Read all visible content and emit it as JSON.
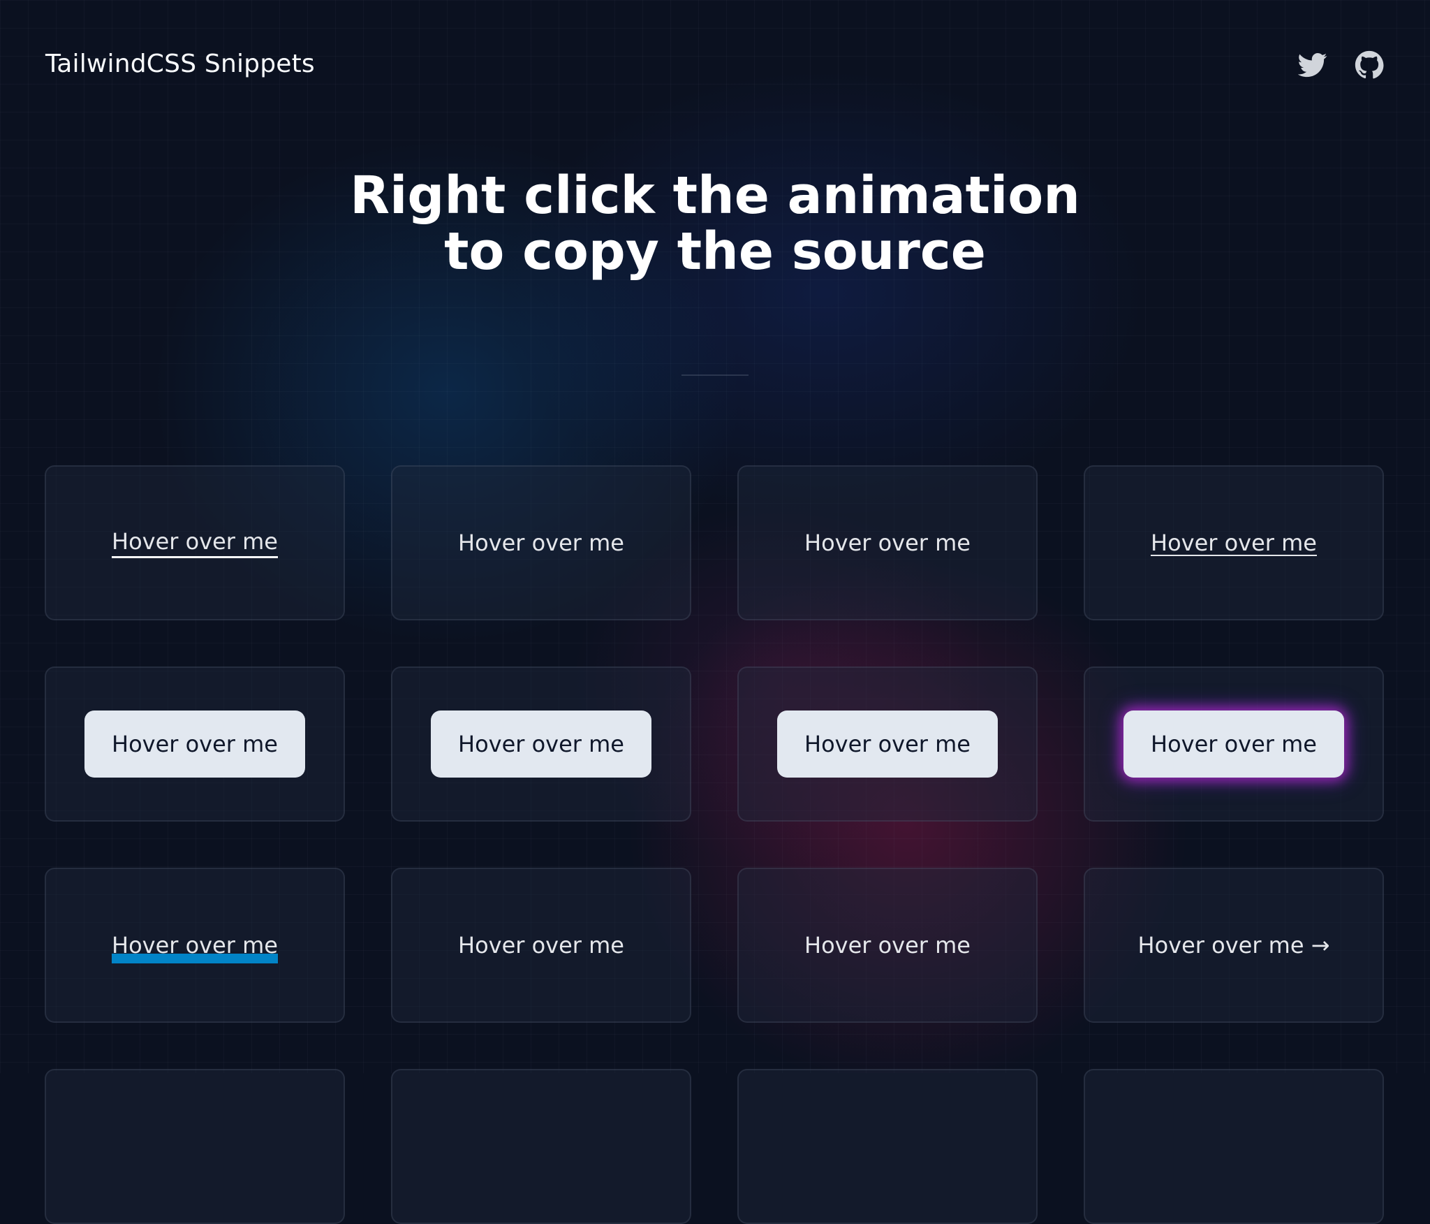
{
  "header": {
    "brand": "TailwindCSS Snippets",
    "icons": [
      "twitter-icon",
      "github-icon"
    ]
  },
  "hero": {
    "line1": "Right click the animation",
    "line2": "to copy the source"
  },
  "cards": [
    {
      "label": "Hover over me",
      "style": "underline"
    },
    {
      "label": "Hover over me",
      "style": "plain"
    },
    {
      "label": "Hover over me",
      "style": "plain"
    },
    {
      "label": "Hover over me",
      "style": "thin-underline"
    },
    {
      "label": "Hover over me",
      "style": "button"
    },
    {
      "label": "Hover over me",
      "style": "button"
    },
    {
      "label": "Hover over me",
      "style": "button"
    },
    {
      "label": "Hover over me",
      "style": "button-glow"
    },
    {
      "label": "Hover over me",
      "style": "highlight-bar"
    },
    {
      "label": "Hover over me",
      "style": "plain"
    },
    {
      "label": "Hover over me",
      "style": "plain"
    },
    {
      "label": "Hover over me →",
      "style": "arrow"
    }
  ],
  "colors": {
    "background": "#0b1120",
    "card_border": "#334155",
    "button_bg": "#e2e8f0",
    "highlight_bar": "#0284c7",
    "glow_pink": "#c026d3",
    "glow_violet": "#7c3aed"
  }
}
